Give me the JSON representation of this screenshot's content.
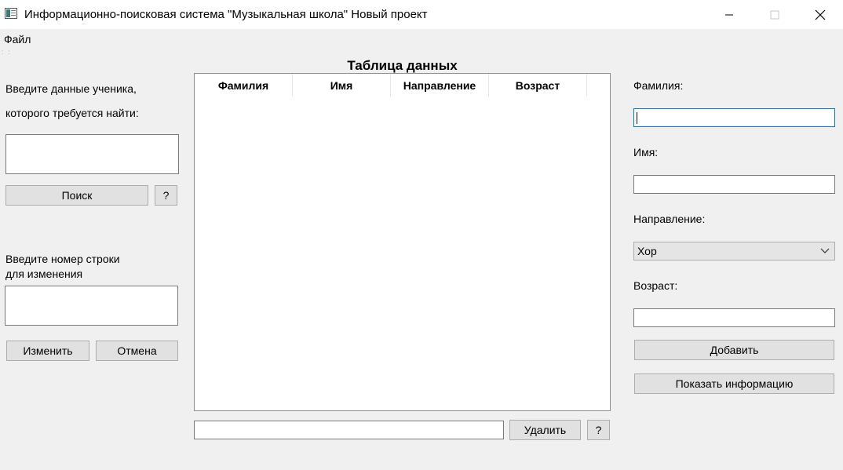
{
  "window": {
    "title": "Информационно-поисковая система \"Музыкальная школа\" Новый проект",
    "app_icon": "app-window-icon",
    "controls": [
      "minimize-icon",
      "maximize-icon",
      "close-icon"
    ]
  },
  "menu": {
    "file_label": "Файл"
  },
  "left_panel": {
    "search_prompt_line1": "Введите данные ученика,",
    "search_prompt_line2": "которого требуется найти:",
    "search_input_value": "",
    "search_button": "Поиск",
    "search_help_button": "?",
    "edit_prompt_line1": "Введите номер строки",
    "edit_prompt_line2": "для изменения",
    "edit_input_value": "",
    "edit_button": "Изменить",
    "cancel_button": "Отмена"
  },
  "table": {
    "title": "Таблица данных",
    "columns": [
      "Фамилия",
      "Имя",
      "Направление",
      "Возраст"
    ],
    "rows": []
  },
  "bottom_bar": {
    "delete_input_value": "",
    "delete_button": "Удалить",
    "delete_help_button": "?"
  },
  "right_panel": {
    "surname_label": "Фамилия:",
    "surname_value": "",
    "name_label": "Имя:",
    "name_value": "",
    "direction_label": "Направление:",
    "direction_selected": "Хор",
    "age_label": "Возраст:",
    "age_value": "",
    "add_button": "Добавить",
    "show_info_button": "Показать информацию"
  },
  "colors": {
    "window_bg": "#f0f0f0",
    "titlebar_bg": "#ffffff",
    "focus_border": "#0078d7",
    "button_bg": "#e1e1e1"
  }
}
